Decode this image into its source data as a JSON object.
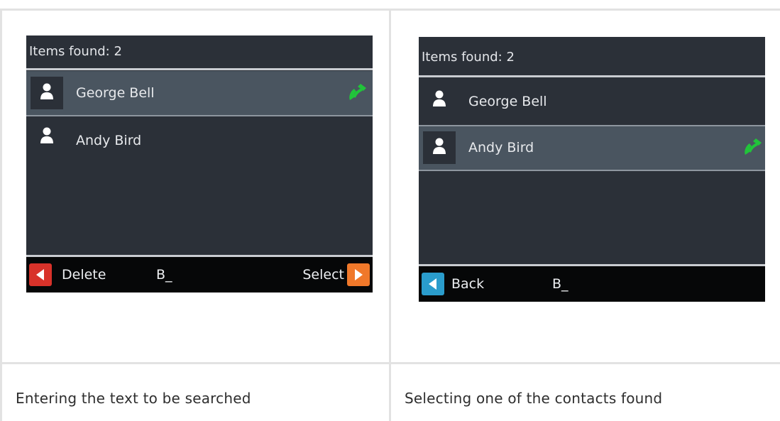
{
  "panels": [
    {
      "header": "Items found: 2",
      "contacts": [
        {
          "name": "George Bell",
          "selected": true
        },
        {
          "name": "Andy Bird",
          "selected": false
        }
      ],
      "softkeys": {
        "left": "Delete",
        "input": "B_",
        "right": "Select"
      },
      "caption": "Entering the text to be searched"
    },
    {
      "header": "Items found: 2",
      "contacts": [
        {
          "name": "George Bell",
          "selected": false
        },
        {
          "name": "Andy Bird",
          "selected": true
        }
      ],
      "softkeys": {
        "left": "Back",
        "input": "B_"
      },
      "caption": "Selecting one of the contacts found"
    }
  ],
  "colors": {
    "screen_bg": "#2b3038",
    "selected_row": "#4a5560",
    "call_icon": "#21c43a",
    "delete_key": "#d8322a",
    "select_key": "#f0782a",
    "back_key": "#2a9ccc"
  },
  "icons": [
    "person-icon",
    "phone-call-icon",
    "arrow-left-icon",
    "arrow-right-icon"
  ]
}
